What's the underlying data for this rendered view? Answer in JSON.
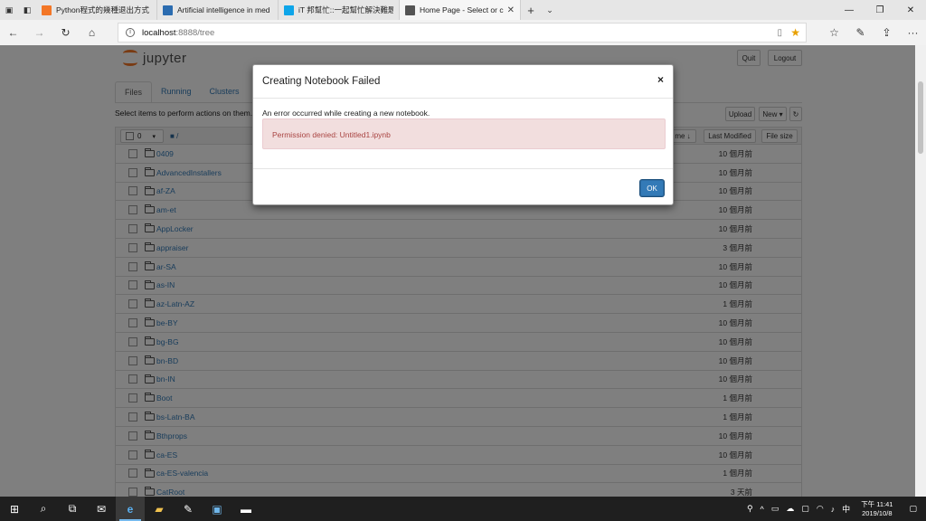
{
  "browser": {
    "tabs": [
      {
        "title": "Python程式的幾種退出方式",
        "icon": "tab-favicon-jupyter",
        "color": "#f37626"
      },
      {
        "title": "Artificial intelligence in med",
        "icon": "tab-favicon-article",
        "color": "#2b6cb0"
      },
      {
        "title": "iT 邦幫忙::一起幫忙解決難題",
        "icon": "tab-favicon-ithome",
        "color": "#0ea5e9"
      },
      {
        "title": "Home Page - Select or c",
        "icon": "tab-favicon-page",
        "color": "#555555"
      }
    ],
    "url_host": "localhost",
    "url_path": ":8888/tree"
  },
  "jupyter": {
    "logo_text": "jupyter",
    "quit_label": "Quit",
    "logout_label": "Logout",
    "tabs": [
      "Files",
      "Running",
      "Clusters"
    ],
    "select_hint": "Select items to perform actions on them.",
    "upload_label": "Upload",
    "new_label": "New ▾",
    "refresh_icon": "↻",
    "select_count": "0",
    "breadcrumb": "/",
    "name_sort_label": "me ↓",
    "last_modified_label": "Last Modified",
    "file_size_label": "File size",
    "rows": [
      {
        "name": "0409",
        "modified": "10 個月前"
      },
      {
        "name": "AdvancedInstallers",
        "modified": "10 個月前"
      },
      {
        "name": "af-ZA",
        "modified": "10 個月前"
      },
      {
        "name": "am-et",
        "modified": "10 個月前"
      },
      {
        "name": "AppLocker",
        "modified": "10 個月前"
      },
      {
        "name": "appraiser",
        "modified": "3 個月前"
      },
      {
        "name": "ar-SA",
        "modified": "10 個月前"
      },
      {
        "name": "as-IN",
        "modified": "10 個月前"
      },
      {
        "name": "az-Latn-AZ",
        "modified": "1 個月前"
      },
      {
        "name": "be-BY",
        "modified": "10 個月前"
      },
      {
        "name": "bg-BG",
        "modified": "10 個月前"
      },
      {
        "name": "bn-BD",
        "modified": "10 個月前"
      },
      {
        "name": "bn-IN",
        "modified": "10 個月前"
      },
      {
        "name": "Boot",
        "modified": "1 個月前"
      },
      {
        "name": "bs-Latn-BA",
        "modified": "1 個月前"
      },
      {
        "name": "Bthprops",
        "modified": "10 個月前"
      },
      {
        "name": "ca-ES",
        "modified": "10 個月前"
      },
      {
        "name": "ca-ES-valencia",
        "modified": "1 個月前"
      },
      {
        "name": "CatRoot",
        "modified": "3 天前"
      }
    ]
  },
  "modal": {
    "title": "Creating Notebook Failed",
    "message": "An error occurred while creating a new notebook.",
    "error": "Permission denied: Untitled1.ipynb",
    "ok_label": "OK",
    "close_glyph": "×"
  },
  "taskbar": {
    "time": "下午 11:41",
    "date": "2019/10/8",
    "ime": "中"
  }
}
